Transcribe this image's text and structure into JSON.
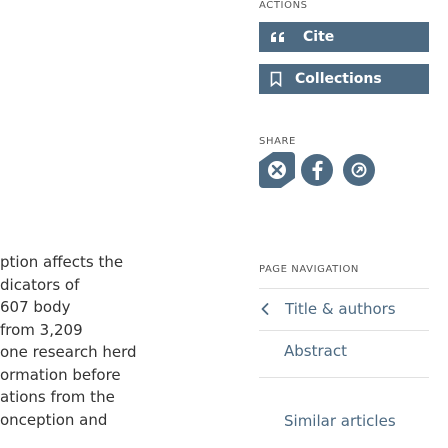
{
  "article": {
    "lines": [
      "ption affects the",
      "dicators of",
      "607 body",
      " from 3,209",
      " one research herd",
      "ormation before",
      "ations from the",
      "onception and"
    ]
  },
  "actions": {
    "heading": "ACTIONS",
    "cite_label": "Cite",
    "collections_label": "Collections"
  },
  "share": {
    "heading": "SHARE",
    "icons": [
      "x-twitter-icon",
      "facebook-icon",
      "share-link-icon"
    ]
  },
  "page_navigation": {
    "heading": "PAGE NAVIGATION",
    "items": [
      {
        "label": "Title & authors"
      },
      {
        "label": "Abstract"
      },
      {
        "label": "Similar articles"
      }
    ]
  },
  "colors": {
    "accent": "#4d6a82",
    "divider": "#e1e1e1"
  }
}
